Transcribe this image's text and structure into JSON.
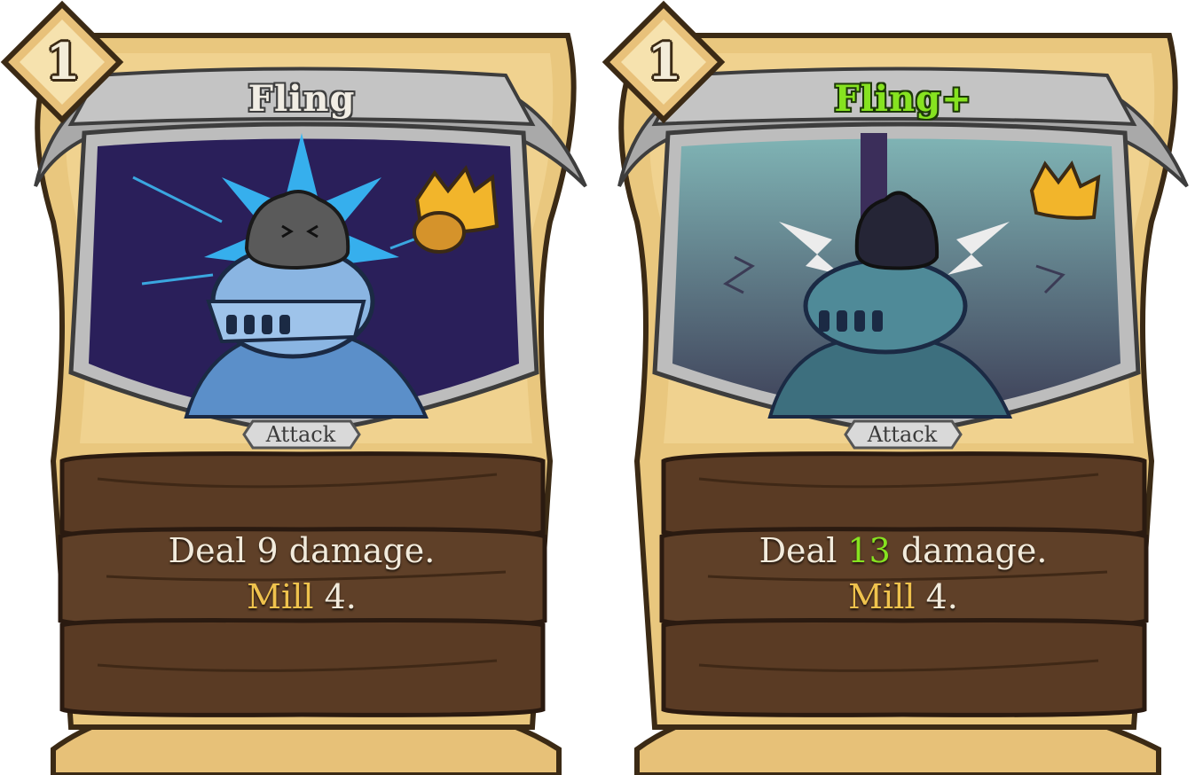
{
  "cards": [
    {
      "cost": "1",
      "title": "Fling",
      "type": "Attack",
      "desc": {
        "line1_pre": "Deal ",
        "damage": "9",
        "line1_post": " damage.",
        "keyword": "Mill",
        "line2_post": " 4."
      },
      "colors": {
        "title": "#f1ede4",
        "art_bg": "#2a1f5a",
        "burst": "#37b7f5"
      }
    },
    {
      "cost": "1",
      "title": "Fling+",
      "type": "Attack",
      "desc": {
        "line1_pre": "Deal ",
        "damage": "13",
        "line1_post": " damage.",
        "keyword": "Mill",
        "line2_post": " 4."
      },
      "colors": {
        "title": "#86e320",
        "art_bg": "#6f9fa3",
        "burst": "#e9ecec"
      }
    }
  ],
  "icons": [
    "cost-gem-icon",
    "crown-icon",
    "knight-helmet-icon",
    "rock-icon"
  ]
}
